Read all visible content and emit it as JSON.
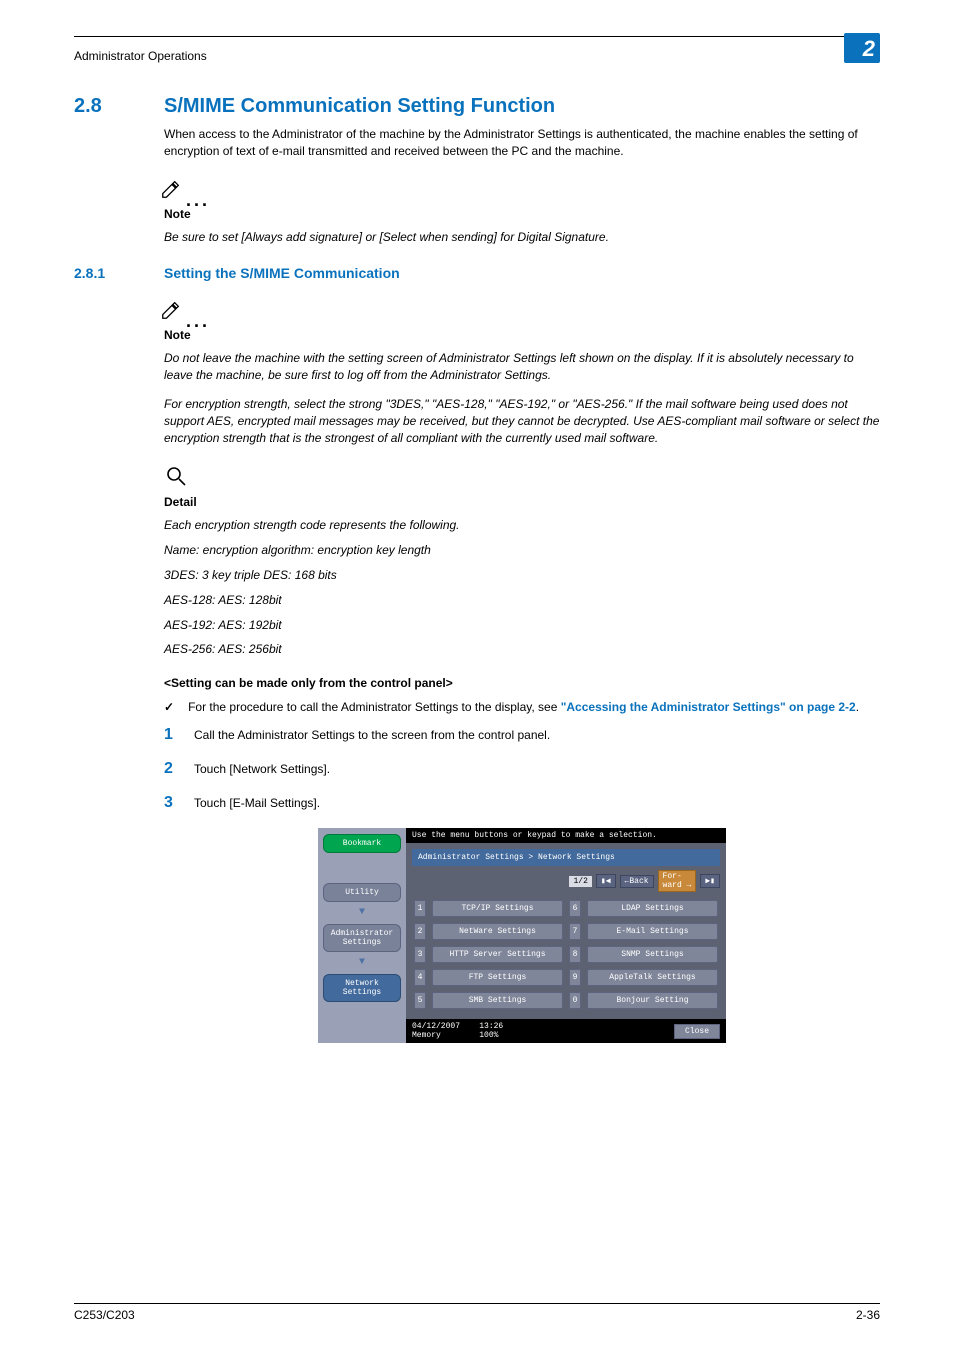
{
  "header": {
    "section_title": "Administrator Operations",
    "chapter_number": "2"
  },
  "section": {
    "number": "2.8",
    "title": "S/MIME Communication Setting Function",
    "intro": "When access to the Administrator of the machine by the Administrator Settings is authenticated, the machine enables the setting of encryption of text of e-mail transmitted and received between the PC and the machine."
  },
  "note1": {
    "label": "Note",
    "text": "Be sure to set [Always add signature] or [Select when sending] for Digital Signature."
  },
  "subsection": {
    "number": "2.8.1",
    "title": "Setting the S/MIME Communication"
  },
  "note2": {
    "label": "Note",
    "p1": "Do not leave the machine with the setting screen of Administrator Settings left shown on the display. If it is absolutely necessary to leave the machine, be sure first to log off from the Administrator Settings.",
    "p2": "For encryption strength, select the strong \"3DES,\" \"AES-128,\" \"AES-192,\" or \"AES-256.\" If the mail software being used does not support AES, encrypted mail messages may be received, but they cannot be decrypted. Use AES-compliant mail software or select the encryption strength that is the strongest of all compliant with the currently used mail software."
  },
  "detail": {
    "label": "Detail",
    "l1": "Each encryption strength code represents the following.",
    "l2": "Name: encryption algorithm: encryption key length",
    "l3": "3DES: 3 key triple DES: 168 bits",
    "l4": "AES-128: AES: 128bit",
    "l5": "AES-192: AES: 192bit",
    "l6": "AES-256: AES: 256bit"
  },
  "panel_heading": "<Setting can be made only from the control panel>",
  "procedure_ref": {
    "prefix": "For the procedure to call the Administrator Settings to the display, see ",
    "link": "\"Accessing the Administrator Settings\" on page 2-2",
    "suffix": "."
  },
  "steps": {
    "s1": {
      "num": "1",
      "text": "Call the Administrator Settings to the screen from the control panel."
    },
    "s2": {
      "num": "2",
      "text": "Touch [Network Settings]."
    },
    "s3": {
      "num": "3",
      "text": "Touch [E-Mail Settings]."
    }
  },
  "screenshot": {
    "top_msg": "Use the menu buttons or keypad to make a selection.",
    "breadcrumb": "Administrator Settings > Network Settings",
    "page_indicator": "1/2",
    "back_label": "Back",
    "fwd_label": "For-\nward",
    "left_nav": {
      "bookmark": "Bookmark",
      "utility": "Utility",
      "admin": "Administrator\nSettings",
      "network": "Network\nSettings"
    },
    "grid": {
      "n1": "1",
      "b1": "TCP/IP Settings",
      "n2": "2",
      "b2": "NetWare Settings",
      "n3": "3",
      "b3": "HTTP Server Settings",
      "n4": "4",
      "b4": "FTP Settings",
      "n5": "5",
      "b5": "SMB Settings",
      "n6": "6",
      "b6": "LDAP Settings",
      "n7": "7",
      "b7": "E-Mail Settings",
      "n8": "8",
      "b8": "SNMP Settings",
      "n9": "9",
      "b9": "AppleTalk Settings",
      "n0": "0",
      "b0": "Bonjour Setting"
    },
    "footer": {
      "date": "04/12/2007",
      "time": "13:26",
      "mem_label": "Memory",
      "mem_val": "100%",
      "close": "Close"
    }
  },
  "footer": {
    "model": "C253/C203",
    "page": "2-36"
  }
}
